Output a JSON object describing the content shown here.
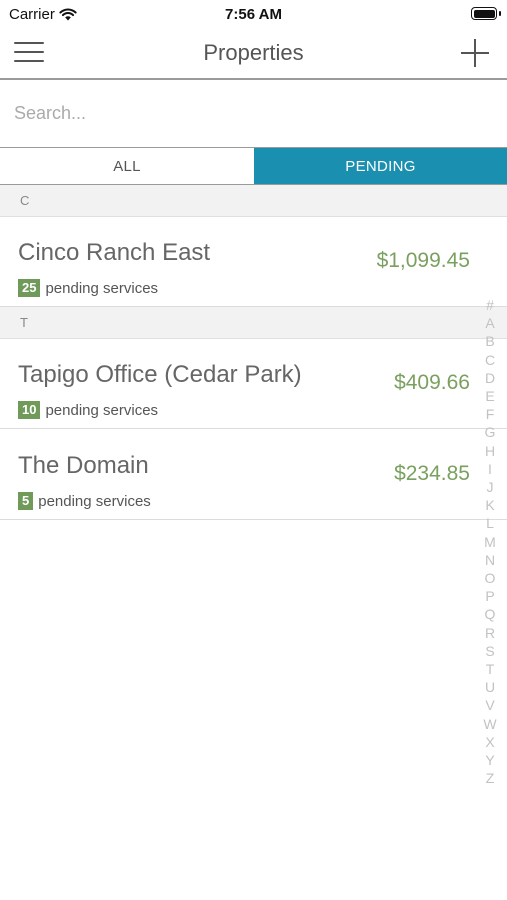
{
  "status": {
    "carrier": "Carrier",
    "time": "7:56 AM"
  },
  "nav": {
    "title": "Properties"
  },
  "search": {
    "placeholder": "Search..."
  },
  "tabs": [
    {
      "label": "ALL",
      "active": false
    },
    {
      "label": "PENDING",
      "active": true
    }
  ],
  "sections": [
    {
      "letter": "C"
    },
    {
      "letter": "T"
    }
  ],
  "properties": [
    {
      "name": "Cinco Ranch East",
      "count": "25",
      "suffix": "pending services",
      "amount": "$1,099.45"
    },
    {
      "name": "Tapigo Office (Cedar Park)",
      "count": "10",
      "suffix": "pending services",
      "amount": "$409.66"
    },
    {
      "name": "The Domain",
      "count": "5",
      "suffix": "pending services",
      "amount": "$234.85"
    }
  ],
  "index": [
    "#",
    "A",
    "B",
    "C",
    "D",
    "E",
    "F",
    "G",
    "H",
    "I",
    "J",
    "K",
    "L",
    "M",
    "N",
    "O",
    "P",
    "Q",
    "R",
    "S",
    "T",
    "U",
    "V",
    "W",
    "X",
    "Y",
    "Z"
  ],
  "colors": {
    "accent": "#1a8fb0",
    "amount": "#7aa05f",
    "badge": "#6f9a5a"
  }
}
